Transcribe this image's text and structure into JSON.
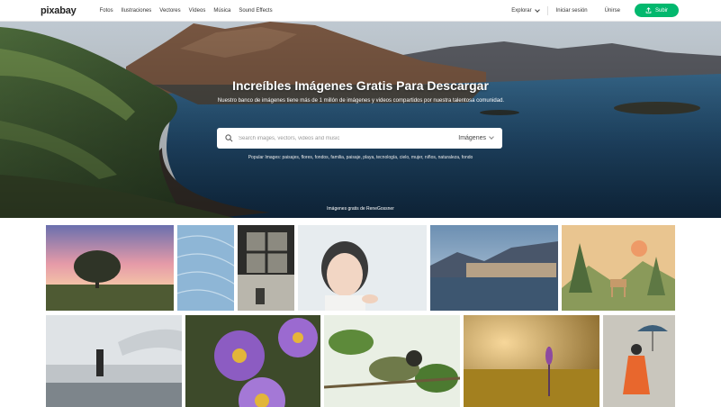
{
  "nav": {
    "logo": "pixabay",
    "links": [
      "Fotos",
      "Ilustraciones",
      "Vectores",
      "Vídeos",
      "Música",
      "Sound Effects"
    ],
    "explore": "Explorar",
    "login": "Iniciar sesión",
    "join": "Únirse",
    "upload": "Subir"
  },
  "hero": {
    "title": "Increíbles Imágenes Gratis Para Descargar",
    "subtitle": "Nuestro banco de imágenes tiene más de 1 millón de imágenes y videos compartidos por nuestra talentosa comunidad.",
    "search_placeholder": "Search images, vectors, videos and music",
    "search_type": "Imágenes",
    "popular": "Popular Images: paisajes, flores, fondos, familia, paisaje, playa, tecnología, cielo, mujer, niños, naturaleza, fondo",
    "credit": "Imágenes gratis de ReneGossner"
  },
  "colors": {
    "accent": "#02b86e",
    "text": "#333333"
  },
  "icons": [
    "upload-icon",
    "search-icon",
    "chevron-down-icon"
  ]
}
